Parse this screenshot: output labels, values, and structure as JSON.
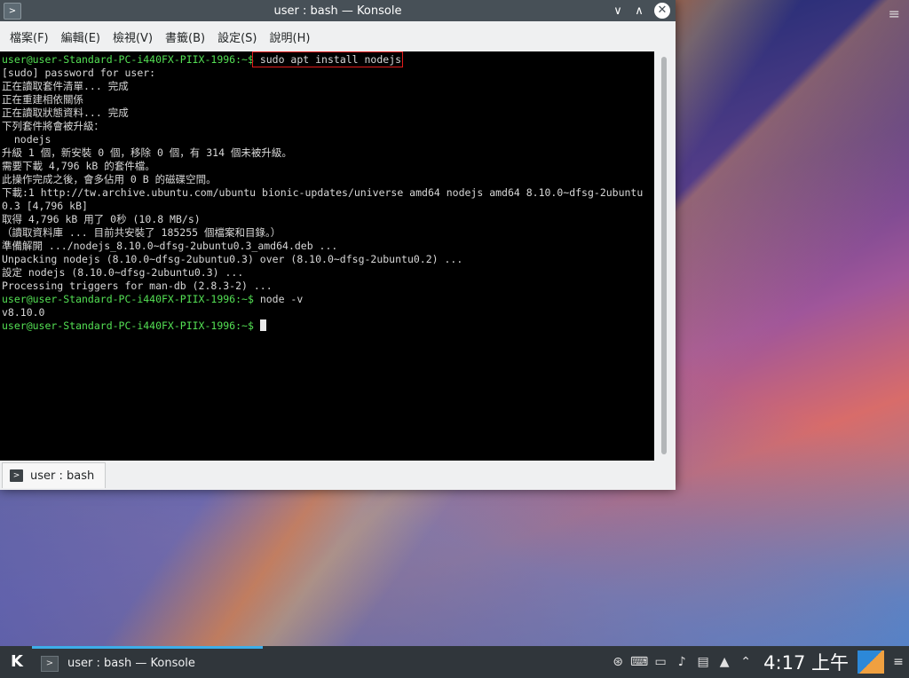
{
  "window": {
    "title": "user : bash — Konsole",
    "app_icon": ">",
    "controls": {
      "minimize": "∨",
      "maximize": "∧",
      "close": "✕"
    }
  },
  "menubar": {
    "items": [
      "檔案(F)",
      "編輯(E)",
      "檢視(V)",
      "書籤(B)",
      "設定(S)",
      "說明(H)"
    ]
  },
  "terminal": {
    "prompt": "user@user-Standard-PC-i440FX-PIIX-1996:~$",
    "command1": "sudo apt install nodejs",
    "output": [
      "[sudo] password for user:",
      "正在讀取套件清單... 完成",
      "正在重建相依關係",
      "正在讀取狀態資料... 完成",
      "下列套件將會被升級：",
      "  nodejs",
      "升級 1 個，新安裝 0 個，移除 0 個，有 314 個未被升級。",
      "需要下載 4,796 kB 的套件檔。",
      "此操作完成之後，會多佔用 0 B 的磁碟空間。",
      "下載:1 http://tw.archive.ubuntu.com/ubuntu bionic-updates/universe amd64 nodejs amd64 8.10.0~dfsg-2ubuntu",
      "0.3 [4,796 kB]",
      "取得 4,796 kB 用了 0秒 (10.8 MB/s)",
      "（讀取資料庫 ... 目前共安裝了 185255 個檔案和目錄。）",
      "準備解開 .../nodejs_8.10.0~dfsg-2ubuntu0.3_amd64.deb ...",
      "Unpacking nodejs (8.10.0~dfsg-2ubuntu0.3) over (8.10.0~dfsg-2ubuntu0.2) ...",
      "設定 nodejs (8.10.0~dfsg-2ubuntu0.3) ...",
      "Processing triggers for man-db (2.8.3-2) ..."
    ],
    "command2": "node -v",
    "output2": "v8.10.0"
  },
  "tabbar": {
    "tab_label": "user : bash",
    "tab_icon": ">"
  },
  "panel": {
    "launcher_icon": "kde-icon",
    "task_label": "user : bash — Konsole",
    "task_icon": ">",
    "clock": "4:17 上午",
    "tray_icons": [
      "network-icon",
      "keyboard-icon",
      "display-icon",
      "volume-icon",
      "clipboard-icon",
      "lock-icon",
      "expand-tray-icon"
    ]
  },
  "colors": {
    "titlebar": "#475057",
    "prompt": "#54e054",
    "highlight_box": "#e31b1b",
    "panel": "#30363b",
    "accent": "#3daee9"
  }
}
